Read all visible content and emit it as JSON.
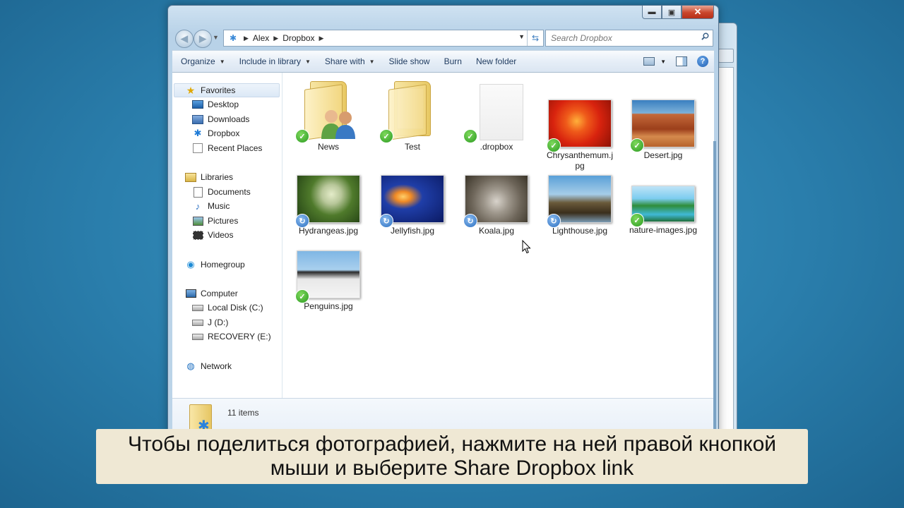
{
  "window": {
    "caption_buttons": [
      "minimize-icon",
      "maximize-icon",
      "close-icon"
    ]
  },
  "navigation": {
    "breadcrumb": [
      "Alex",
      "Dropbox"
    ],
    "search_placeholder": "Search Dropbox"
  },
  "toolbar": {
    "items": [
      {
        "label": "Organize",
        "dropdown": true
      },
      {
        "label": "Include in library",
        "dropdown": true
      },
      {
        "label": "Share with",
        "dropdown": true
      },
      {
        "label": "Slide show",
        "dropdown": false
      },
      {
        "label": "Burn",
        "dropdown": false
      },
      {
        "label": "New folder",
        "dropdown": false
      }
    ]
  },
  "sidebar": {
    "favorites": {
      "label": "Favorites",
      "items": [
        "Desktop",
        "Downloads",
        "Dropbox",
        "Recent Places"
      ]
    },
    "libraries": {
      "label": "Libraries",
      "items": [
        "Documents",
        "Music",
        "Pictures",
        "Videos"
      ]
    },
    "homegroup": {
      "label": "Homegroup"
    },
    "computer": {
      "label": "Computer",
      "items": [
        "Local Disk (C:)",
        "J (D:)",
        "RECOVERY (E:)"
      ]
    },
    "network": {
      "label": "Network"
    }
  },
  "files": [
    {
      "name": "News",
      "kind": "folder-people",
      "status": "synced"
    },
    {
      "name": "Test",
      "kind": "folder-docs",
      "status": "synced"
    },
    {
      "name": ".dropbox",
      "kind": "file",
      "status": "synced"
    },
    {
      "name": "Chrysanthemum.jpg",
      "kind": "photo",
      "status": "synced"
    },
    {
      "name": "Desert.jpg",
      "kind": "photo",
      "status": "synced"
    },
    {
      "name": "Hydrangeas.jpg",
      "kind": "photo",
      "status": "syncing"
    },
    {
      "name": "Jellyfish.jpg",
      "kind": "photo",
      "status": "syncing"
    },
    {
      "name": "Koala.jpg",
      "kind": "photo",
      "status": "syncing"
    },
    {
      "name": "Lighthouse.jpg",
      "kind": "photo",
      "status": "syncing"
    },
    {
      "name": "nature-images.jpg",
      "kind": "photo",
      "status": "synced"
    },
    {
      "name": "Penguins.jpg",
      "kind": "photo",
      "status": "synced"
    }
  ],
  "details": {
    "count_text": "11 items"
  },
  "subtitle": {
    "line1": "Чтобы поделиться фотографией, нажмите на ней правой кнопкой",
    "line2": "мыши и выберите Share Dropbox link"
  },
  "colors": {
    "desktop": "#2a7eac",
    "synced_badge": "#2a9a21",
    "syncing_badge": "#2c6fc0",
    "subtitle_bg": "#efe8d4"
  }
}
